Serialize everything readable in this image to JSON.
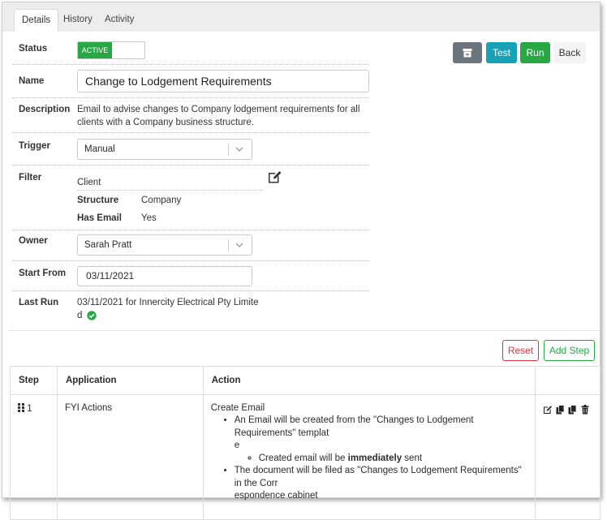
{
  "tabs": [
    "Details",
    "History",
    "Activity"
  ],
  "fields": {
    "status": {
      "label": "Status",
      "toggle_text": "ACTIVE"
    },
    "name": {
      "label": "Name",
      "value": "Change to Lodgement Requirements"
    },
    "description": {
      "label": "Description",
      "line1": "Email to advise changes to Company lodgement requirements for all",
      "line2": "clients with a Company business structure."
    },
    "trigger": {
      "label": "Trigger",
      "value": "Manual"
    },
    "filter": {
      "label": "Filter",
      "client": "Client",
      "structure_label": "Structure",
      "structure_value": "Company",
      "has_email_label": "Has Email",
      "has_email_value": "Yes"
    },
    "owner": {
      "label": "Owner",
      "value": "Sarah Pratt"
    },
    "start_from": {
      "label": "Start From",
      "value": "03/11/2021"
    },
    "last_run": {
      "label": "Last Run",
      "line1": "03/11/2021 for Innercity Electrical Pty Limite",
      "line2": "d"
    }
  },
  "toolbar": {
    "test": "Test",
    "run": "Run",
    "back": "Back"
  },
  "step_actions": {
    "reset": "Reset",
    "add_step": "Add Step"
  },
  "table": {
    "headers": [
      "Step",
      "Application",
      "Action"
    ],
    "rows": [
      {
        "step": "1",
        "application": "FYI Actions",
        "action_title": "Create Email",
        "bullet1_line1": "An Email will be created from the \"Changes to Lodgement Requirements\" templat",
        "bullet1_line2": "e",
        "sub_prefix": "Created email will be ",
        "sub_bold": "immediately",
        "sub_suffix": " sent",
        "bullet2_line1": "The document will be filed as \"Changes to Lodgement Requirements\" in the Corr",
        "bullet2_line2": "espondence cabinet"
      }
    ]
  },
  "colors": {
    "success": "#28a745",
    "info": "#17a2b8",
    "secondary": "#6c757d",
    "danger": "#dc3545"
  },
  "icons": [
    "archive-icon",
    "edit-icon",
    "check-circle-icon",
    "drag-handle-icon",
    "copy-icon",
    "delete-icon",
    "chevron-down-icon"
  ]
}
